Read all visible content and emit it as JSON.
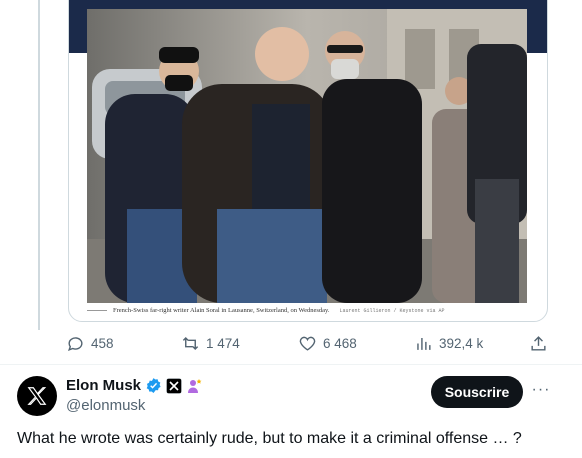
{
  "quoted_article": {
    "caption": "French-Swiss far-right writer Alain Soral in Lausanne, Switzerland, on Wednesday.",
    "credit": "Laurent Gillieron / Keystone via AP",
    "photo_description_icon": "news-photo"
  },
  "actions": {
    "replies": "458",
    "reposts": "1 474",
    "likes": "6 468",
    "views": "392,4 k"
  },
  "reply": {
    "name": "Elon Musk",
    "handle": "@elonmusk",
    "subscribe_label": "Souscrire",
    "more_label": "···",
    "text": "What he wrote was certainly rude, but to make it a criminal offense … ?"
  },
  "colors": {
    "text_primary": "#0f1419",
    "text_secondary": "#536471",
    "verified_blue": "#1d9bf0",
    "divider": "#eff3f4",
    "header_navy": "#1b2a4a"
  }
}
